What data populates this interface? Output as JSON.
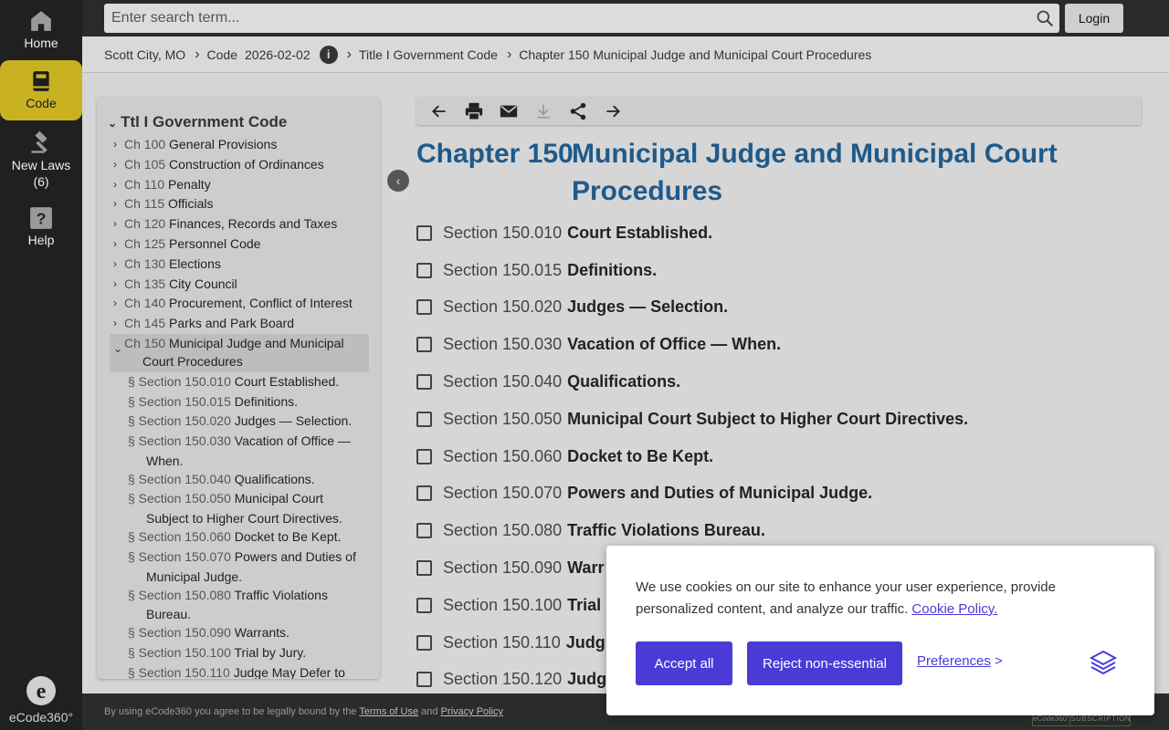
{
  "colors": {
    "accent": "#c9b222",
    "link_title": "#1f5a8a",
    "cookie_button": "#4a3bd7",
    "rail_bg": "#202020"
  },
  "rail": {
    "home": {
      "label": "Home",
      "icon": "home-icon"
    },
    "code": {
      "label": "Code",
      "icon": "book-icon"
    },
    "new_laws": {
      "label": "New Laws",
      "count": "(6)",
      "icon": "gavel-icon"
    },
    "help": {
      "label": "Help",
      "icon": "question-icon"
    },
    "logo": "eCode360°"
  },
  "search": {
    "placeholder": "Enter search term...",
    "value": ""
  },
  "login_label": "Login",
  "breadcrumb": {
    "municipality": "Scott City, MO",
    "code": "Code",
    "date": "2026-02-02",
    "title": "Title I Government Code",
    "chapter": "Chapter 150 Municipal Judge and Municipal Court Procedures"
  },
  "toc": {
    "title": "Ttl I Government Code",
    "chapters": [
      {
        "num": "Ch 100",
        "name": "General Provisions"
      },
      {
        "num": "Ch 105",
        "name": "Construction of Ordinances"
      },
      {
        "num": "Ch 110",
        "name": "Penalty"
      },
      {
        "num": "Ch 115",
        "name": "Officials"
      },
      {
        "num": "Ch 120",
        "name": "Finances, Records and Taxes"
      },
      {
        "num": "Ch 125",
        "name": "Personnel Code"
      },
      {
        "num": "Ch 130",
        "name": "Elections"
      },
      {
        "num": "Ch 135",
        "name": "City Council"
      },
      {
        "num": "Ch 140",
        "name": "Procurement, Conflict of Interest"
      },
      {
        "num": "Ch 145",
        "name": "Parks and Park Board"
      }
    ],
    "open_chapter": {
      "num": "Ch 150",
      "name_a": "Municipal Judge and Municipal",
      "name_b": "Court Procedures"
    },
    "sections": [
      {
        "num": "§ Section 150.010",
        "name": "Court Established."
      },
      {
        "num": "§ Section 150.015",
        "name": "Definitions."
      },
      {
        "num": "§ Section 150.020",
        "name": "Judges — Selection."
      },
      {
        "num": "§ Section 150.030",
        "name": "Vacation of Office —",
        "name2": "When."
      },
      {
        "num": "§ Section 150.040",
        "name": "Qualifications."
      },
      {
        "num": "§ Section 150.050",
        "name": "Municipal Court",
        "name2": "Subject to Higher Court Directives."
      },
      {
        "num": "§ Section 150.060",
        "name": "Docket to Be Kept."
      },
      {
        "num": "§ Section 150.070",
        "name": "Powers and Duties of",
        "name2": "Municipal Judge."
      },
      {
        "num": "§ Section 150.080",
        "name": "Traffic Violations",
        "name2": "Bureau."
      },
      {
        "num": "§ Section 150.090",
        "name": "Warrants."
      },
      {
        "num": "§ Section 150.100",
        "name": "Trial by Jury."
      },
      {
        "num": "§ Section 150.110",
        "name": "Judge May Defer to"
      }
    ]
  },
  "chapter": {
    "num": "Chapter 150",
    "name": "Municipal Judge and Municipal Court Procedures"
  },
  "sections": [
    {
      "num": "Section 150.010",
      "name": "Court Established."
    },
    {
      "num": "Section 150.015",
      "name": "Definitions."
    },
    {
      "num": "Section 150.020",
      "name": "Judges — Selection."
    },
    {
      "num": "Section 150.030",
      "name": "Vacation of Office — When."
    },
    {
      "num": "Section 150.040",
      "name": "Qualifications."
    },
    {
      "num": "Section 150.050",
      "name": "Municipal Court Subject to Higher Court Directives."
    },
    {
      "num": "Section 150.060",
      "name": "Docket to Be Kept."
    },
    {
      "num": "Section 150.070",
      "name": "Powers and Duties of Municipal Judge."
    },
    {
      "num": "Section 150.080",
      "name": "Traffic Violations Bureau."
    },
    {
      "num": "Section 150.090",
      "name": "Warr"
    },
    {
      "num": "Section 150.100",
      "name": "Trial"
    },
    {
      "num": "Section 150.110",
      "name": "Judg"
    },
    {
      "num": "Section 150.120",
      "name": "Judg"
    }
  ],
  "footer": {
    "text_a": "By using eCode360 you agree to be legally bound by the",
    "terms": "Terms of Use",
    "and": "and",
    "privacy": "Privacy Policy",
    "badge_a": "eCode360°",
    "badge_b": "SUBSCRIPTION"
  },
  "cookie": {
    "text": "We use cookies on our site to enhance your user experience, provide personalized content, and analyze our traffic.",
    "policy_link": "Cookie Policy.",
    "accept": "Accept all",
    "reject": "Reject non-essential",
    "preferences": "Preferences",
    "preferences_arrow": ">"
  }
}
